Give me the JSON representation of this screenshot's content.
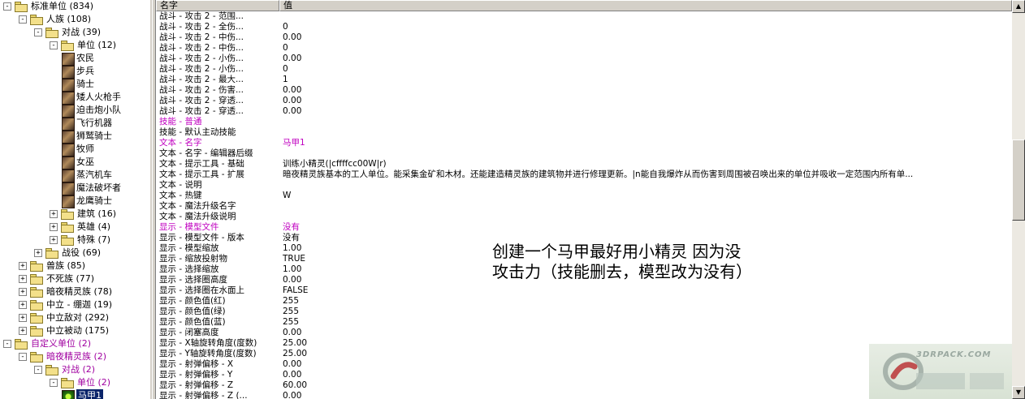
{
  "tree": {
    "items": [
      {
        "label": "标准单位",
        "count": "(834)",
        "level": 0,
        "exp": "-",
        "icon": "folder"
      },
      {
        "label": "人族",
        "count": "(108)",
        "level": 1,
        "exp": "-",
        "icon": "folder"
      },
      {
        "label": "对战",
        "count": "(39)",
        "level": 2,
        "exp": "-",
        "icon": "folder"
      },
      {
        "label": "单位",
        "count": "(12)",
        "level": 3,
        "exp": "-",
        "icon": "folder"
      },
      {
        "label": "农民",
        "count": "",
        "level": 4,
        "exp": "",
        "icon": "unit"
      },
      {
        "label": "步兵",
        "count": "",
        "level": 4,
        "exp": "",
        "icon": "unit"
      },
      {
        "label": "骑士",
        "count": "",
        "level": 4,
        "exp": "",
        "icon": "unit"
      },
      {
        "label": "矮人火枪手",
        "count": "",
        "level": 4,
        "exp": "",
        "icon": "unit"
      },
      {
        "label": "迫击炮小队",
        "count": "",
        "level": 4,
        "exp": "",
        "icon": "unit"
      },
      {
        "label": "飞行机器",
        "count": "",
        "level": 4,
        "exp": "",
        "icon": "unit"
      },
      {
        "label": "狮鹫骑士",
        "count": "",
        "level": 4,
        "exp": "",
        "icon": "unit"
      },
      {
        "label": "牧师",
        "count": "",
        "level": 4,
        "exp": "",
        "icon": "unit"
      },
      {
        "label": "女巫",
        "count": "",
        "level": 4,
        "exp": "",
        "icon": "unit"
      },
      {
        "label": "蒸汽机车",
        "count": "",
        "level": 4,
        "exp": "",
        "icon": "unit"
      },
      {
        "label": "魔法破坏者",
        "count": "",
        "level": 4,
        "exp": "",
        "icon": "unit"
      },
      {
        "label": "龙鹰骑士",
        "count": "",
        "level": 4,
        "exp": "",
        "icon": "unit"
      },
      {
        "label": "建筑",
        "count": "(16)",
        "level": 3,
        "exp": "+",
        "icon": "folder"
      },
      {
        "label": "英雄",
        "count": "(4)",
        "level": 3,
        "exp": "+",
        "icon": "folder"
      },
      {
        "label": "特殊",
        "count": "(7)",
        "level": 3,
        "exp": "+",
        "icon": "folder"
      },
      {
        "label": "战役",
        "count": "(69)",
        "level": 2,
        "exp": "+",
        "icon": "folder"
      },
      {
        "label": "兽族",
        "count": "(85)",
        "level": 1,
        "exp": "+",
        "icon": "folder"
      },
      {
        "label": "不死族",
        "count": "(77)",
        "level": 1,
        "exp": "+",
        "icon": "folder"
      },
      {
        "label": "暗夜精灵族",
        "count": "(78)",
        "level": 1,
        "exp": "+",
        "icon": "folder"
      },
      {
        "label": "中立 - 绷迦",
        "count": "(19)",
        "level": 1,
        "exp": "+",
        "icon": "folder"
      },
      {
        "label": "中立敌对",
        "count": "(292)",
        "level": 1,
        "exp": "+",
        "icon": "folder"
      },
      {
        "label": "中立被动",
        "count": "(175)",
        "level": 1,
        "exp": "+",
        "icon": "folder"
      },
      {
        "label": "自定义单位",
        "count": "(2)",
        "level": 0,
        "exp": "-",
        "icon": "folder",
        "purple": true
      },
      {
        "label": "暗夜精灵族",
        "count": "(2)",
        "level": 1,
        "exp": "-",
        "icon": "folder",
        "purple": true
      },
      {
        "label": "对战",
        "count": "(2)",
        "level": 2,
        "exp": "-",
        "icon": "folder",
        "purple": true
      },
      {
        "label": "单位",
        "count": "(2)",
        "level": 3,
        "exp": "-",
        "icon": "folder",
        "purple": true
      },
      {
        "label": "马甲1",
        "count": "",
        "level": 4,
        "exp": "",
        "icon": "unit-green",
        "selected": true
      }
    ]
  },
  "grid": {
    "header_name": "名字",
    "header_value": "值",
    "rows": [
      {
        "k": "战斗 - 攻击 2 - 范围...",
        "v": ""
      },
      {
        "k": "战斗 - 攻击 2 - 全伤...",
        "v": "0"
      },
      {
        "k": "战斗 - 攻击 2 - 中伤...",
        "v": "0.00"
      },
      {
        "k": "战斗 - 攻击 2 - 中伤...",
        "v": "0"
      },
      {
        "k": "战斗 - 攻击 2 - 小伤...",
        "v": "0.00"
      },
      {
        "k": "战斗 - 攻击 2 - 小伤...",
        "v": "0"
      },
      {
        "k": "战斗 - 攻击 2 - 最大...",
        "v": "1"
      },
      {
        "k": "战斗 - 攻击 2 - 伤害...",
        "v": "0.00"
      },
      {
        "k": "战斗 - 攻击 2 - 穿透...",
        "v": "0.00"
      },
      {
        "k": "战斗 - 攻击 2 - 穿透...",
        "v": "0.00"
      },
      {
        "k": "技能 - 普通",
        "v": "",
        "mod": true
      },
      {
        "k": "技能 - 默认主动技能",
        "v": ""
      },
      {
        "k": "文本 - 名字",
        "v": "马甲1",
        "mod": true
      },
      {
        "k": "文本 - 名字 - 编辑器后缀",
        "v": ""
      },
      {
        "k": "文本 - 提示工具 - 基础",
        "v": "训练小精灵(|cffffcc00W|r)"
      },
      {
        "k": "文本 - 提示工具 - 扩展",
        "v": "暗夜精灵族基本的工人单位。能采集金矿和木材。还能建造精灵族的建筑物并进行修理更新。|n能自我爆炸从而伤害到周围被召唤出来的单位并吸收一定范围内所有单..."
      },
      {
        "k": "文本 - 说明",
        "v": ""
      },
      {
        "k": "文本 - 热键",
        "v": "W"
      },
      {
        "k": "文本 - 魔法升级名字",
        "v": ""
      },
      {
        "k": "文本 - 魔法升级说明",
        "v": ""
      },
      {
        "k": "显示 - 模型文件",
        "v": "没有",
        "mod": true
      },
      {
        "k": "显示 - 模型文件 - 版本",
        "v": "没有"
      },
      {
        "k": "显示 - 模型缩放",
        "v": "1.00"
      },
      {
        "k": "显示 - 缩放投射物",
        "v": "TRUE"
      },
      {
        "k": "显示 - 选择缩放",
        "v": "1.00"
      },
      {
        "k": "显示 - 选择圈高度",
        "v": "0.00"
      },
      {
        "k": "显示 - 选择圈在水面上",
        "v": "FALSE"
      },
      {
        "k": "显示 - 颜色值(红)",
        "v": "255"
      },
      {
        "k": "显示 - 颜色值(绿)",
        "v": "255"
      },
      {
        "k": "显示 - 颜色值(蓝)",
        "v": "255"
      },
      {
        "k": "显示 - 闭塞高度",
        "v": "0.00"
      },
      {
        "k": "显示 - X轴旋转角度(度数)",
        "v": "25.00"
      },
      {
        "k": "显示 - Y轴旋转角度(度数)",
        "v": "25.00"
      },
      {
        "k": "显示 - 射弹偏移 - X",
        "v": "0.00"
      },
      {
        "k": "显示 - 射弹偏移 - Y",
        "v": "0.00"
      },
      {
        "k": "显示 - 射弹偏移 - Z",
        "v": "60.00"
      },
      {
        "k": "显示 - 射弹偏移 - Z (...",
        "v": "0.00"
      }
    ]
  },
  "note": {
    "line1": "创建一个马甲最好用小精灵 因为没",
    "line2": "攻击力（技能删去，模型改为没有）"
  },
  "watermark": {
    "text": "3DRPACK.COM"
  },
  "colors": {
    "modified": "#c000c0",
    "selection": "#0a246a"
  }
}
